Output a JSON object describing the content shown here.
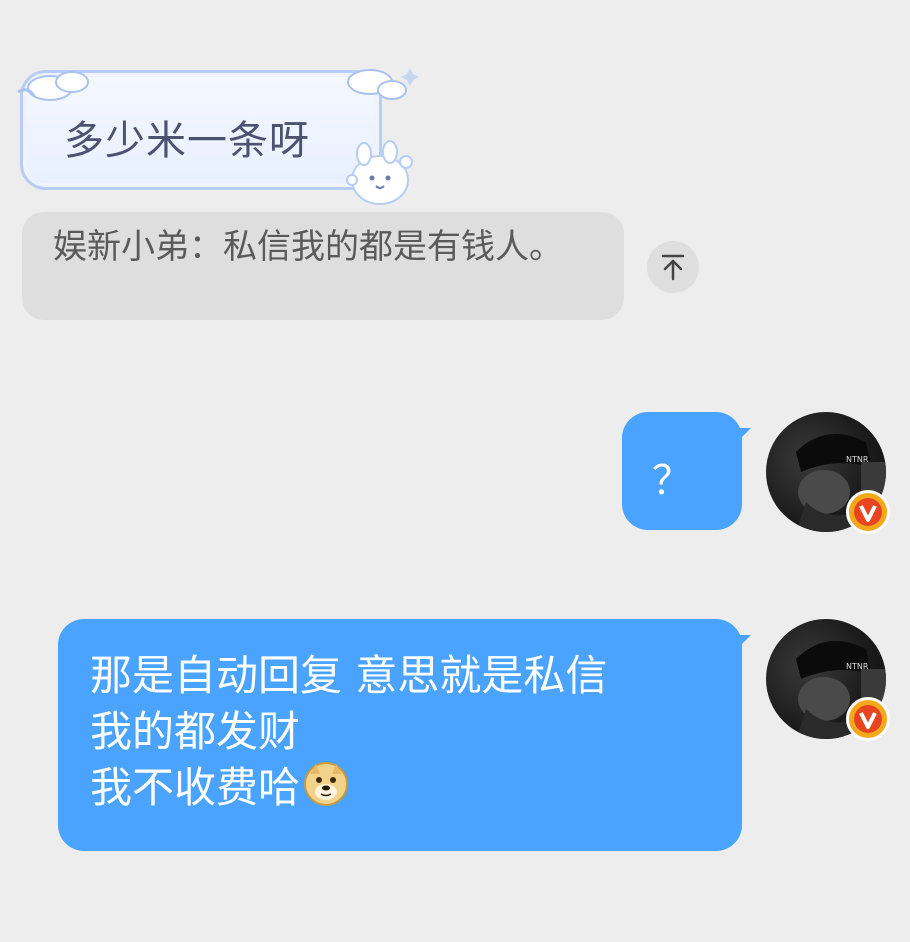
{
  "messages": {
    "incoming_decorated": {
      "text": "多少米一条呀"
    },
    "quoted_reply": {
      "text": "娱新小弟：私信我的都是有钱人。"
    },
    "outgoing_1": {
      "text": "？"
    },
    "outgoing_2": {
      "line1": "那是自动回复 意思就是私信",
      "line2": "我的都发财",
      "line3": "我不收费哈"
    }
  },
  "icons": {
    "scroll_top": "arrow-up-to-top-icon",
    "emoji": "doge-emoji-icon",
    "verified": "verified-v-badge-icon"
  },
  "colors": {
    "background": "#ededed",
    "outgoing_bubble": "#4aa3ff",
    "quote_bg": "#dedede",
    "badge": "#f4a91c",
    "decor_border": "#b7cdf3"
  }
}
